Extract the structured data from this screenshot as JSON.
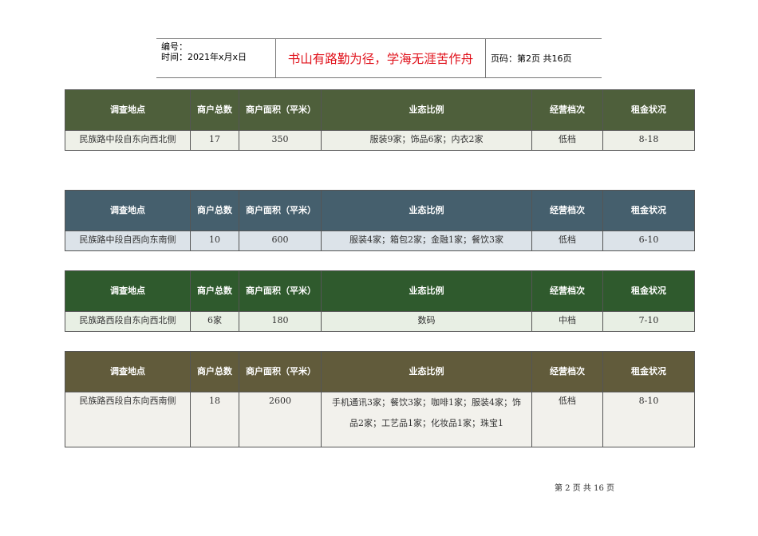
{
  "header": {
    "code_label": "编号：",
    "date": "时间：2021年x月x日",
    "motto": "书山有路勤为径，学海无涯苦作舟",
    "page": "页码：第2页 共16页"
  },
  "columns": [
    "调查地点",
    "商户总数",
    "商户面积（平米）",
    "业态比例",
    "经营档次",
    "租金状况"
  ],
  "tables": [
    {
      "color": "#4e5f3b",
      "row_bg": "#eef0e8",
      "row": [
        "民族路中段自东向西北侧",
        "17",
        "350",
        "服装9家；饰品6家；内衣2家",
        "低档",
        "8-18"
      ]
    },
    {
      "color": "#455f6d",
      "row_bg": "#dce3e9",
      "row": [
        "民族路中段自西向东南侧",
        "10",
        "600",
        "服装4家；箱包2家；金融1家；餐饮3家",
        "低档",
        "6-10"
      ]
    },
    {
      "color": "#2f5a2d",
      "row_bg": "#e8efe4",
      "row": [
        "民族路西段自东向西北侧",
        "6家",
        "180",
        "数码",
        "中档",
        "7-10"
      ]
    },
    {
      "color": "#615b3b",
      "row_bg": "#f2f1ec",
      "row": [
        "民族路西段自东向西南侧",
        "18",
        "2600",
        "手机通讯3家；餐饮3家；咖啡1家；服装4家；饰品2家；工艺品1家；化妆品1家；珠宝1",
        "低档",
        "8-10"
      ]
    }
  ],
  "footer": "第 2 页 共 16 页"
}
